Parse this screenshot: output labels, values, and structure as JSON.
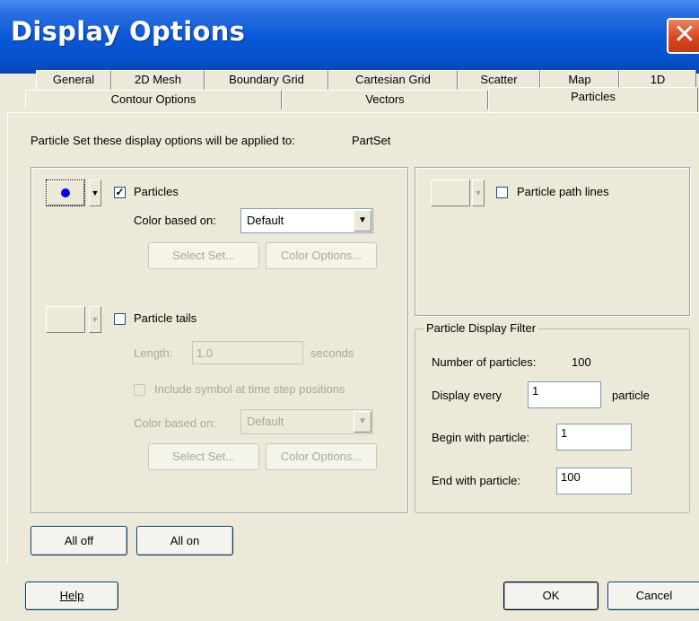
{
  "window": {
    "title": "Display Options",
    "close_glyph": "✕"
  },
  "tabs_row1": [
    "General",
    "2D Mesh",
    "Boundary Grid",
    "Cartesian Grid",
    "Scatter",
    "Map",
    "1D"
  ],
  "tabs_row2": [
    "Contour Options",
    "Vectors",
    "Particles"
  ],
  "active_tab": "Particles",
  "header": {
    "prefix": "Particle Set these display options will be applied to:",
    "set_name": "PartSet"
  },
  "particles": {
    "checkbox_label": "Particles",
    "checked": true,
    "color_label": "Color based on:",
    "color_value": "Default",
    "select_set_label": "Select Set...",
    "color_options_label": "Color Options...",
    "symbol_color": "#0000ee"
  },
  "tails": {
    "checkbox_label": "Particle tails",
    "checked": false,
    "length_label": "Length:",
    "length_value": "1.0",
    "seconds_label": "seconds",
    "include_symbol_label": "Include symbol at time step positions",
    "color_label": "Color based on:",
    "color_value": "Default",
    "select_set_label": "Select Set...",
    "color_options_label": "Color Options..."
  },
  "path_lines": {
    "checkbox_label": "Particle path lines",
    "checked": false
  },
  "filter": {
    "title": "Particle Display Filter",
    "num_label": "Number of particles:",
    "num_value": "100",
    "display_every_label": "Display every",
    "display_every_value": "1",
    "display_every_suffix": "particle",
    "begin_label": "Begin with particle:",
    "begin_value": "1",
    "end_label": "End with particle:",
    "end_value": "100"
  },
  "buttons": {
    "all_off": "All off",
    "all_on": "All on",
    "help": "Help",
    "ok": "OK",
    "cancel": "Cancel"
  },
  "icons": {
    "dropdown": "▼",
    "check": "✓"
  }
}
